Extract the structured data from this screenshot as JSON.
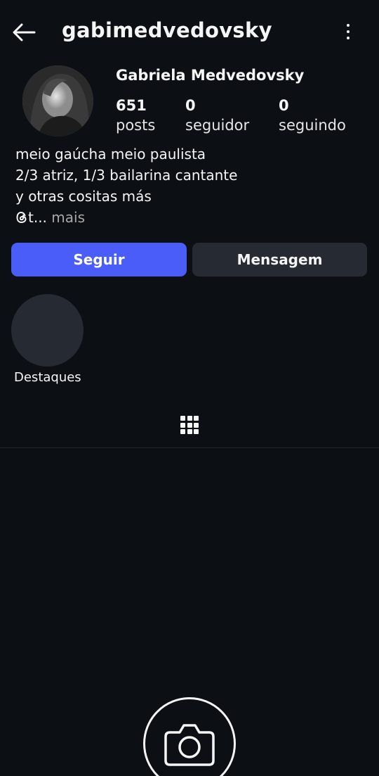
{
  "header": {
    "username": "gabimedvedovsky"
  },
  "profile": {
    "full_name": "Gabriela Medvedovsky",
    "stats": [
      {
        "value": "651",
        "label": "posts"
      },
      {
        "value": "0",
        "label": "seguidor"
      },
      {
        "value": "0",
        "label": "seguindo"
      }
    ],
    "bio": {
      "line1": "meio gaúcha meio paulista",
      "line2": "2/3 atriz, 1/3 bailarina cantante",
      "line3": "y otras cositas más",
      "line4_prefix": "t...",
      "more_label": "mais"
    }
  },
  "actions": {
    "follow_label": "Seguir",
    "message_label": "Mensagem"
  },
  "highlights": {
    "label": "Destaques"
  },
  "icons": {
    "back": "arrow-left-icon",
    "more": "more-vertical-icon",
    "threads": "threads-icon",
    "grid": "grid-icon",
    "camera": "camera-icon"
  },
  "colors": {
    "background": "#0c1014",
    "follow_button": "#4a5df9",
    "secondary_button": "#262a33",
    "text": "#f5f5f5",
    "muted": "#a8a8a8"
  }
}
